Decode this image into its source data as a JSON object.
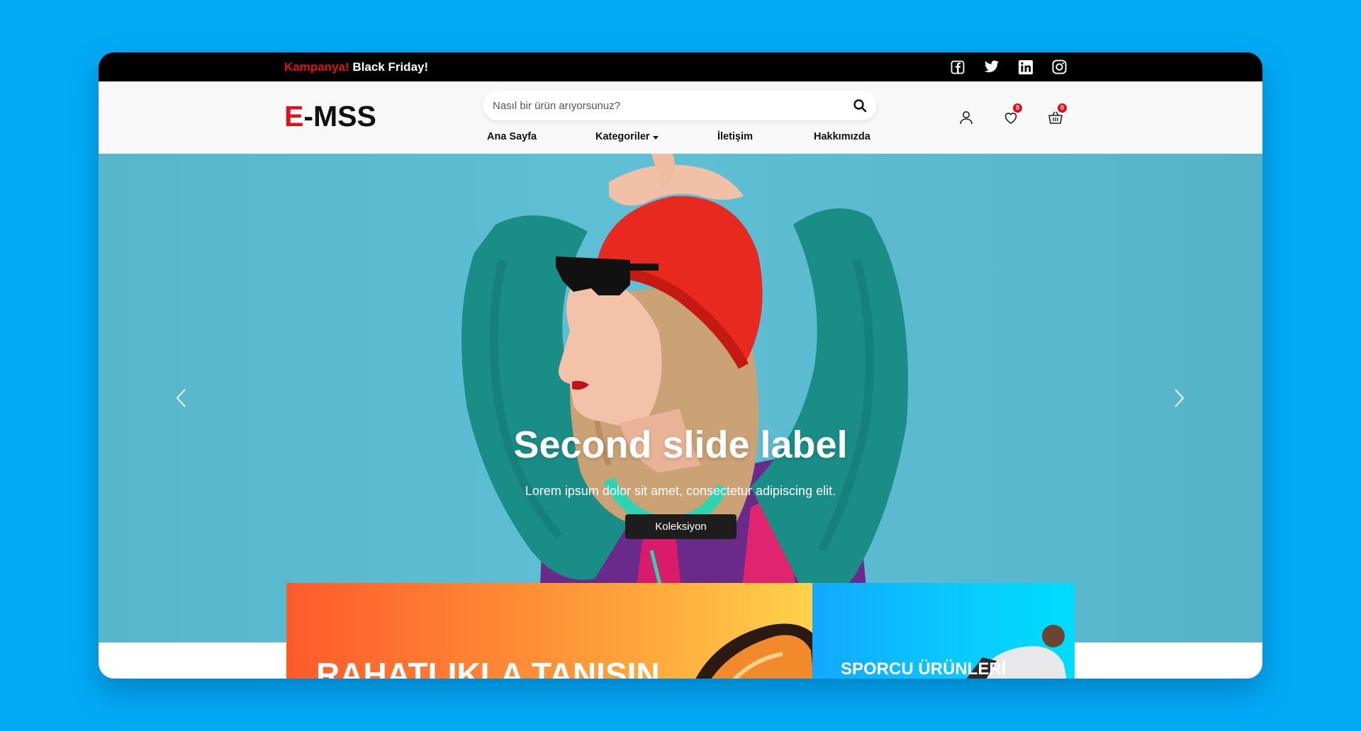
{
  "topbar": {
    "promo_highlight": "Kampanya!",
    "promo_text": "Black Friday!",
    "social_icons": [
      "facebook-icon",
      "twitter-icon",
      "linkedin-icon",
      "instagram-icon"
    ]
  },
  "header": {
    "logo_accent": "E",
    "logo_rest": "-MSS",
    "search_placeholder": "Nasıl bir ürün arıyorsunuz?",
    "nav": [
      {
        "label": "Ana Sayfa"
      },
      {
        "label": "Kategoriler"
      },
      {
        "label": "İletişim"
      },
      {
        "label": "Hakkımızda"
      }
    ],
    "wishlist_count": "0",
    "cart_count": "0"
  },
  "hero": {
    "title": "Second slide label",
    "subtitle": "Lorem ipsum dolor sit amet, consectetur adipiscing elit.",
    "button_label": "Koleksiyon"
  },
  "cards": [
    {
      "title": "RAHATLIKLA TANIŞIN"
    },
    {
      "title": "SPORCU ÜRÜNLERİ"
    }
  ],
  "colors": {
    "page_background": "#02aaf6",
    "accent_red": "#e0101c",
    "topbar": "#000000",
    "hero_background": "#5fbfd4"
  }
}
